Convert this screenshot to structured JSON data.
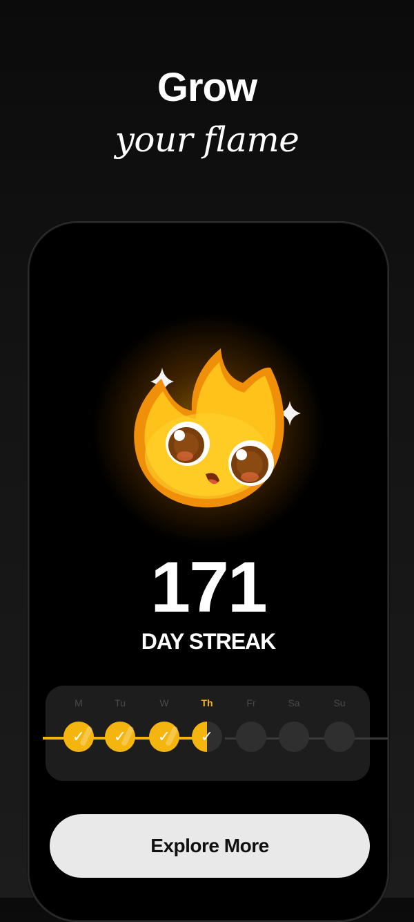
{
  "headline": {
    "line1": "Grow",
    "line2": "your flame"
  },
  "streak": {
    "count": "171",
    "label": "DAY STREAK"
  },
  "week": {
    "days": [
      {
        "label": "M",
        "state": "done",
        "check": "✓"
      },
      {
        "label": "Tu",
        "state": "done",
        "check": "✓"
      },
      {
        "label": "W",
        "state": "done",
        "check": "✓"
      },
      {
        "label": "Th",
        "state": "today",
        "check": "✓"
      },
      {
        "label": "Fr",
        "state": "upcoming",
        "check": ""
      },
      {
        "label": "Sa",
        "state": "upcoming",
        "check": ""
      },
      {
        "label": "Su",
        "state": "upcoming",
        "check": ""
      }
    ]
  },
  "cta": {
    "label": "Explore More"
  },
  "colors": {
    "accent": "#f5b50f",
    "background": "#0b0b0b",
    "button": "#e9e9e9"
  },
  "icons": {
    "mascot": "flame-mascot-icon",
    "sparkle": "sparkle-icon",
    "check": "checkmark-icon"
  }
}
